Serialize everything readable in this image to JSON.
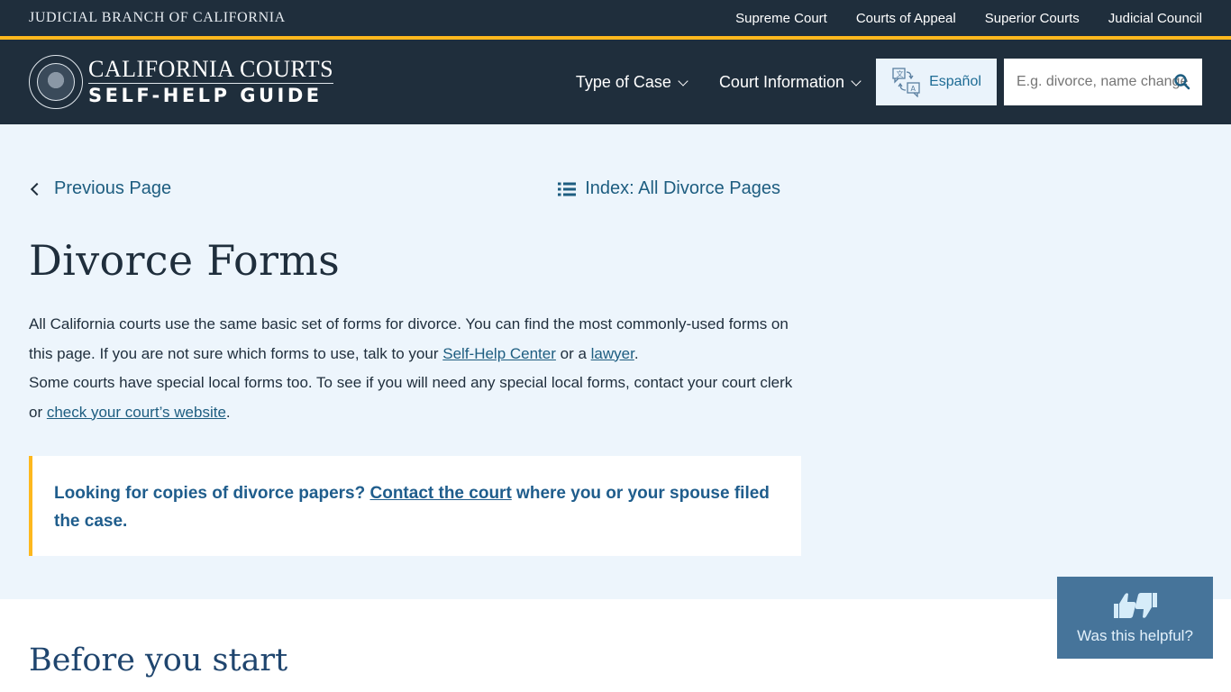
{
  "utility_bar": {
    "title": "JUDICIAL BRANCH OF CALIFORNIA",
    "links": [
      "Supreme Court",
      "Courts of Appeal",
      "Superior Courts",
      "Judicial Council"
    ]
  },
  "header": {
    "logo_line1": "CALIFORNIA COURTS",
    "logo_line2": "SELF-HELP GUIDE",
    "nav": [
      {
        "label": "Type of Case",
        "icon": "chevron-down-icon"
      },
      {
        "label": "Court Information",
        "icon": "chevron-down-icon"
      }
    ],
    "language_button": {
      "label": "Español",
      "icon": "translate-icon"
    },
    "search": {
      "placeholder": "E.g. divorce, name change,",
      "value": "",
      "icon": "search-icon"
    }
  },
  "page_nav": {
    "previous": {
      "label": "Previous Page",
      "icon": "chevron-left-icon"
    },
    "index": {
      "label": "Index: All Divorce Pages",
      "icon": "list-icon"
    }
  },
  "main": {
    "title": "Divorce Forms",
    "intro": {
      "p1_a": "All California courts use the same basic set of forms for divorce. You can find the most commonly-used forms on this page. If you are not sure which forms to use, talk to your ",
      "p1_link1": "Self-Help Center",
      "p1_b": " or a ",
      "p1_link2": "lawyer",
      "p1_c": ".",
      "p2_a": "Some courts have special local forms too. To see if you will need any special local forms, contact your court clerk or ",
      "p2_link": "check your court’s website",
      "p2_b": "."
    },
    "callout": {
      "text_a": "Looking for copies of divorce papers? ",
      "link": "Contact the court",
      "text_b": " where you or your spouse filed the case."
    }
  },
  "section": {
    "title": "Before you start"
  },
  "feedback": {
    "label": "Was this helpful?",
    "icon": "thumbs-up-down-icon"
  },
  "colors": {
    "navy": "#1f2e3c",
    "gold": "#fdb81e",
    "link": "#1d5d80",
    "hero_bg": "#edf5fc",
    "feedback_bg": "#46749a"
  }
}
